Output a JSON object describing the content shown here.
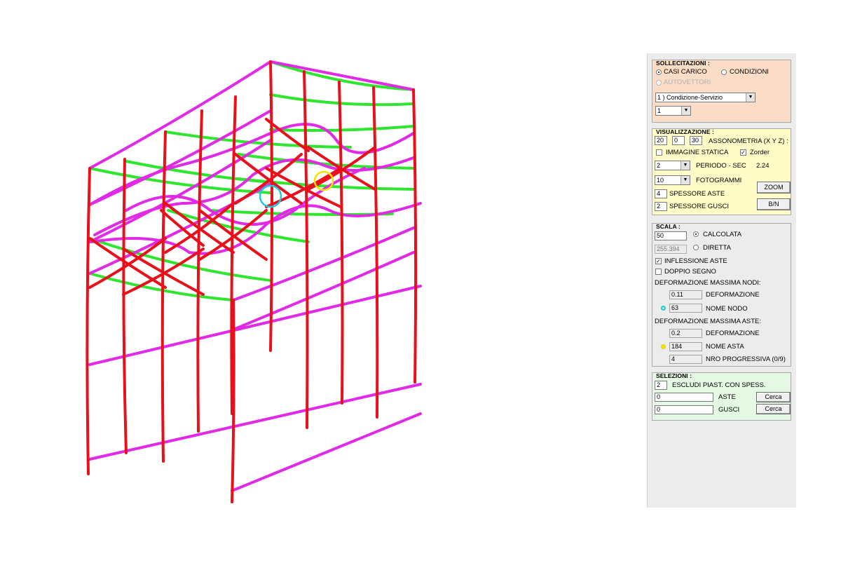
{
  "colors": {
    "columns": "#e8101a",
    "beams_magenta": "#e02ae6",
    "beams_green": "#2ee62e",
    "node_marker": "#1fc8d8",
    "beam_marker": "#f2e400",
    "sollecitazioni_bg": "#fbdcc6",
    "visualizzazione_bg": "#fffcc8",
    "selezioni_bg": "#e4f8e4"
  },
  "sollecitazioni": {
    "title": "SOLLECITAZIONI :",
    "casi_carico": "CASI CARICO",
    "condizioni": "CONDIZIONI",
    "autovettori": "AUTOVETTORI",
    "selected": "casi_carico",
    "condition_select": "1 ) Condizione-Servizio",
    "case_select": "1"
  },
  "visualizzazione": {
    "title": "VISUALIZZAZIONE :",
    "axo_x": "20",
    "axo_y": "0",
    "axo_z": "30",
    "axo_label": "ASSONOMETRIA (X Y Z) :",
    "immagine_statica_label": "IMMAGINE STATICA",
    "immagine_statica": false,
    "zorder_label": "Zorder",
    "zorder": true,
    "periodo_select": "2",
    "periodo_label": "PERIODO - SEC",
    "periodo_value": "2.24",
    "fotogrammi_select": "10",
    "fotogrammi_label": "FOTOGRAMMI",
    "spessore_aste": "4",
    "spessore_aste_label": "SPESSORE ASTE",
    "spessore_gusci": "2",
    "spessore_gusci_label": "SPESSORE GUSCI",
    "zoom_button": "ZOOM",
    "bn_button": "B/N"
  },
  "scala": {
    "title": "SCALA :",
    "calcolata_value": "50",
    "calcolata_label": "CALCOLATA",
    "diretta_value": "255.394",
    "diretta_label": "DIRETTA",
    "selected": "calcolata",
    "inflessione_label": "INFLESSIONE ASTE",
    "inflessione": true,
    "doppio_segno_label": "DOPPIO SEGNO",
    "doppio_segno": false,
    "def_nodi_heading": "DEFORMAZIONE MASSIMA NODI:",
    "def_nodi_value": "0.11",
    "deformazione_label": "DEFORMAZIONE",
    "nome_nodo_value": "63",
    "nome_nodo_label": "NOME NODO",
    "def_aste_heading": "DEFORMAZIONE MASSIMA ASTE:",
    "def_aste_value": "0.2",
    "deformazione_label2": "DEFORMAZIONE",
    "nome_asta_value": "184",
    "nome_asta_label": "NOME ASTA",
    "nro_value": "4",
    "nro_label": "NRO PROGRESSIVA (0/9)"
  },
  "selezioni": {
    "title": "SELEZIONI :",
    "escludi_value": "2",
    "escludi_label": "ESCLUDI PIAST. CON SPESS.",
    "aste_value": "0",
    "aste_label": "ASTE",
    "gusci_value": "0",
    "gusci_label": "GUSCI",
    "cerca_aste": "Cerca",
    "cerca_gusci": "Cerca"
  }
}
